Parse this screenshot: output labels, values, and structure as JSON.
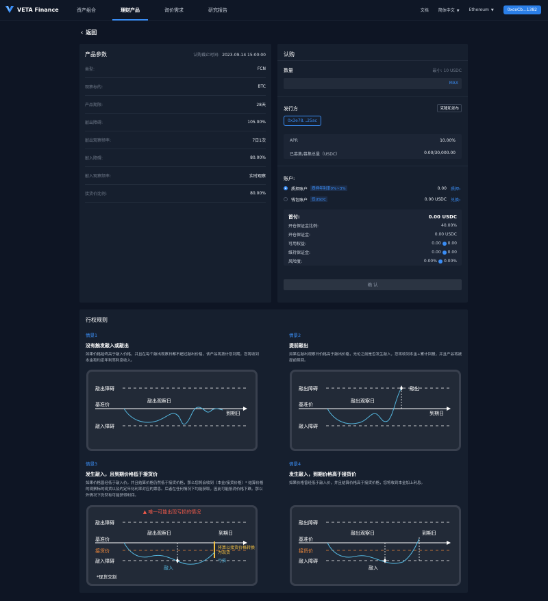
{
  "nav": {
    "logo": "VETA Finance",
    "links": [
      "资产组合",
      "理财产品",
      "询价需求",
      "研究报告"
    ],
    "docs": "文档",
    "language": "简体中文",
    "network": "Ethereum",
    "wallet": "0xceCb...1382"
  },
  "back_label": "返回",
  "params": {
    "title": "产品参数",
    "time_label": "认购截止时间:",
    "time_value": "2023-09-14 15:00:00",
    "rows": [
      {
        "label": "类型:",
        "value": "FCN"
      },
      {
        "label": "观察标的:",
        "value": "BTC"
      },
      {
        "label": "产品期限:",
        "value": "28天"
      },
      {
        "label": "敲出障碍:",
        "value": "105.00%"
      },
      {
        "label": "敲出观察频率:",
        "value": "7日1次"
      },
      {
        "label": "敲入障碍:",
        "value": "80.00%"
      },
      {
        "label": "敲入观察频率:",
        "value": "实时观察"
      },
      {
        "label": "接货价比例:",
        "value": "80.00%"
      }
    ]
  },
  "subscribe": {
    "title": "认购",
    "qty_label": "数量",
    "qty_min": "最小: 10 USDC",
    "qty_max": "MAX",
    "issuer_label": "发行方",
    "issuer_btn": "克隆和发布",
    "issuer_addr": "0x3e78...25ac",
    "apr_label": "APR",
    "apr_value": "10.00%",
    "raised_label": "已募集/募集总量（USDC）",
    "raised_value": "0.00/30,000.00",
    "account_label": "账户:",
    "accounts": [
      {
        "name": "质押账户",
        "tag": "质押年利率0%~3%",
        "amount": "0.00",
        "link": "质押›"
      },
      {
        "name": "钱包账户",
        "tag": "仅USDC",
        "amount": "0.00 USDC",
        "link": "兑换›"
      }
    ],
    "summary": {
      "head_label": "首付:",
      "head_value": "0.00 USDC",
      "rows": [
        {
          "label": "开仓保证金比例:",
          "value": "40.00%"
        },
        {
          "label": "开仓保证金:",
          "value": "0.00 USDC"
        },
        {
          "label": "可用权益:",
          "from": "0.00",
          "to": "0.00"
        },
        {
          "label": "维持保证金:",
          "from": "0.00",
          "to": "0.00"
        },
        {
          "label": "风险度:",
          "from": "0.00%",
          "to": "0.00%"
        }
      ]
    },
    "confirm": "确 认"
  },
  "rules": {
    "title": "行权规则",
    "scenarios": [
      {
        "label": "情景1",
        "title": "没有触发敲入或敲出",
        "desc": "如果价格始终高于敲入价格，并且在每个敲出观察日都不超过敲出价格，该产品将按计划到期，您将收到本金和约定年利率利息收入。"
      },
      {
        "label": "情景2",
        "title": "提前敲出",
        "desc": "如果在敲出观察日价格高于敲出价格，无论之前是否发生敲入，您将收到本金+累计回报，并且产品将被提前赎回。"
      },
      {
        "label": "情景3",
        "title": "发生敲入，且到期价格低于接货价",
        "desc": "如果价格曾经低于敲入价，并且结算价格仍然低于接货价格，那么您将会收到（本金/接货价格）* 结算价格的观察标的现货以及约定年化利率对应的票息。后者在任何情况下均能获取，因此可能抵消价格下跌。那以外情况下仍然有可能获得利润。"
      },
      {
        "label": "情景4",
        "title": "发生敲入，到期价格高于接货价",
        "desc": "如果价格曾经低于敲入价，并且结算价格高于接货价格，您将收到本金加上利息。"
      }
    ],
    "chart_labels": {
      "knock_out": "敲出障碍",
      "base": "基准价",
      "obs_day": "敲出观察日",
      "maturity": "到期日",
      "knock_in": "敲入障碍",
      "knock_out_event": "敲出",
      "strike": "接货价",
      "knock_in_event": "敲入",
      "loss": "亏损",
      "warning": "唯一可能出现亏损的情况",
      "settle_note_1": "将算以接货价格转换",
      "settle_note_2": "为现货",
      "spot_note": "*现货交割"
    }
  }
}
